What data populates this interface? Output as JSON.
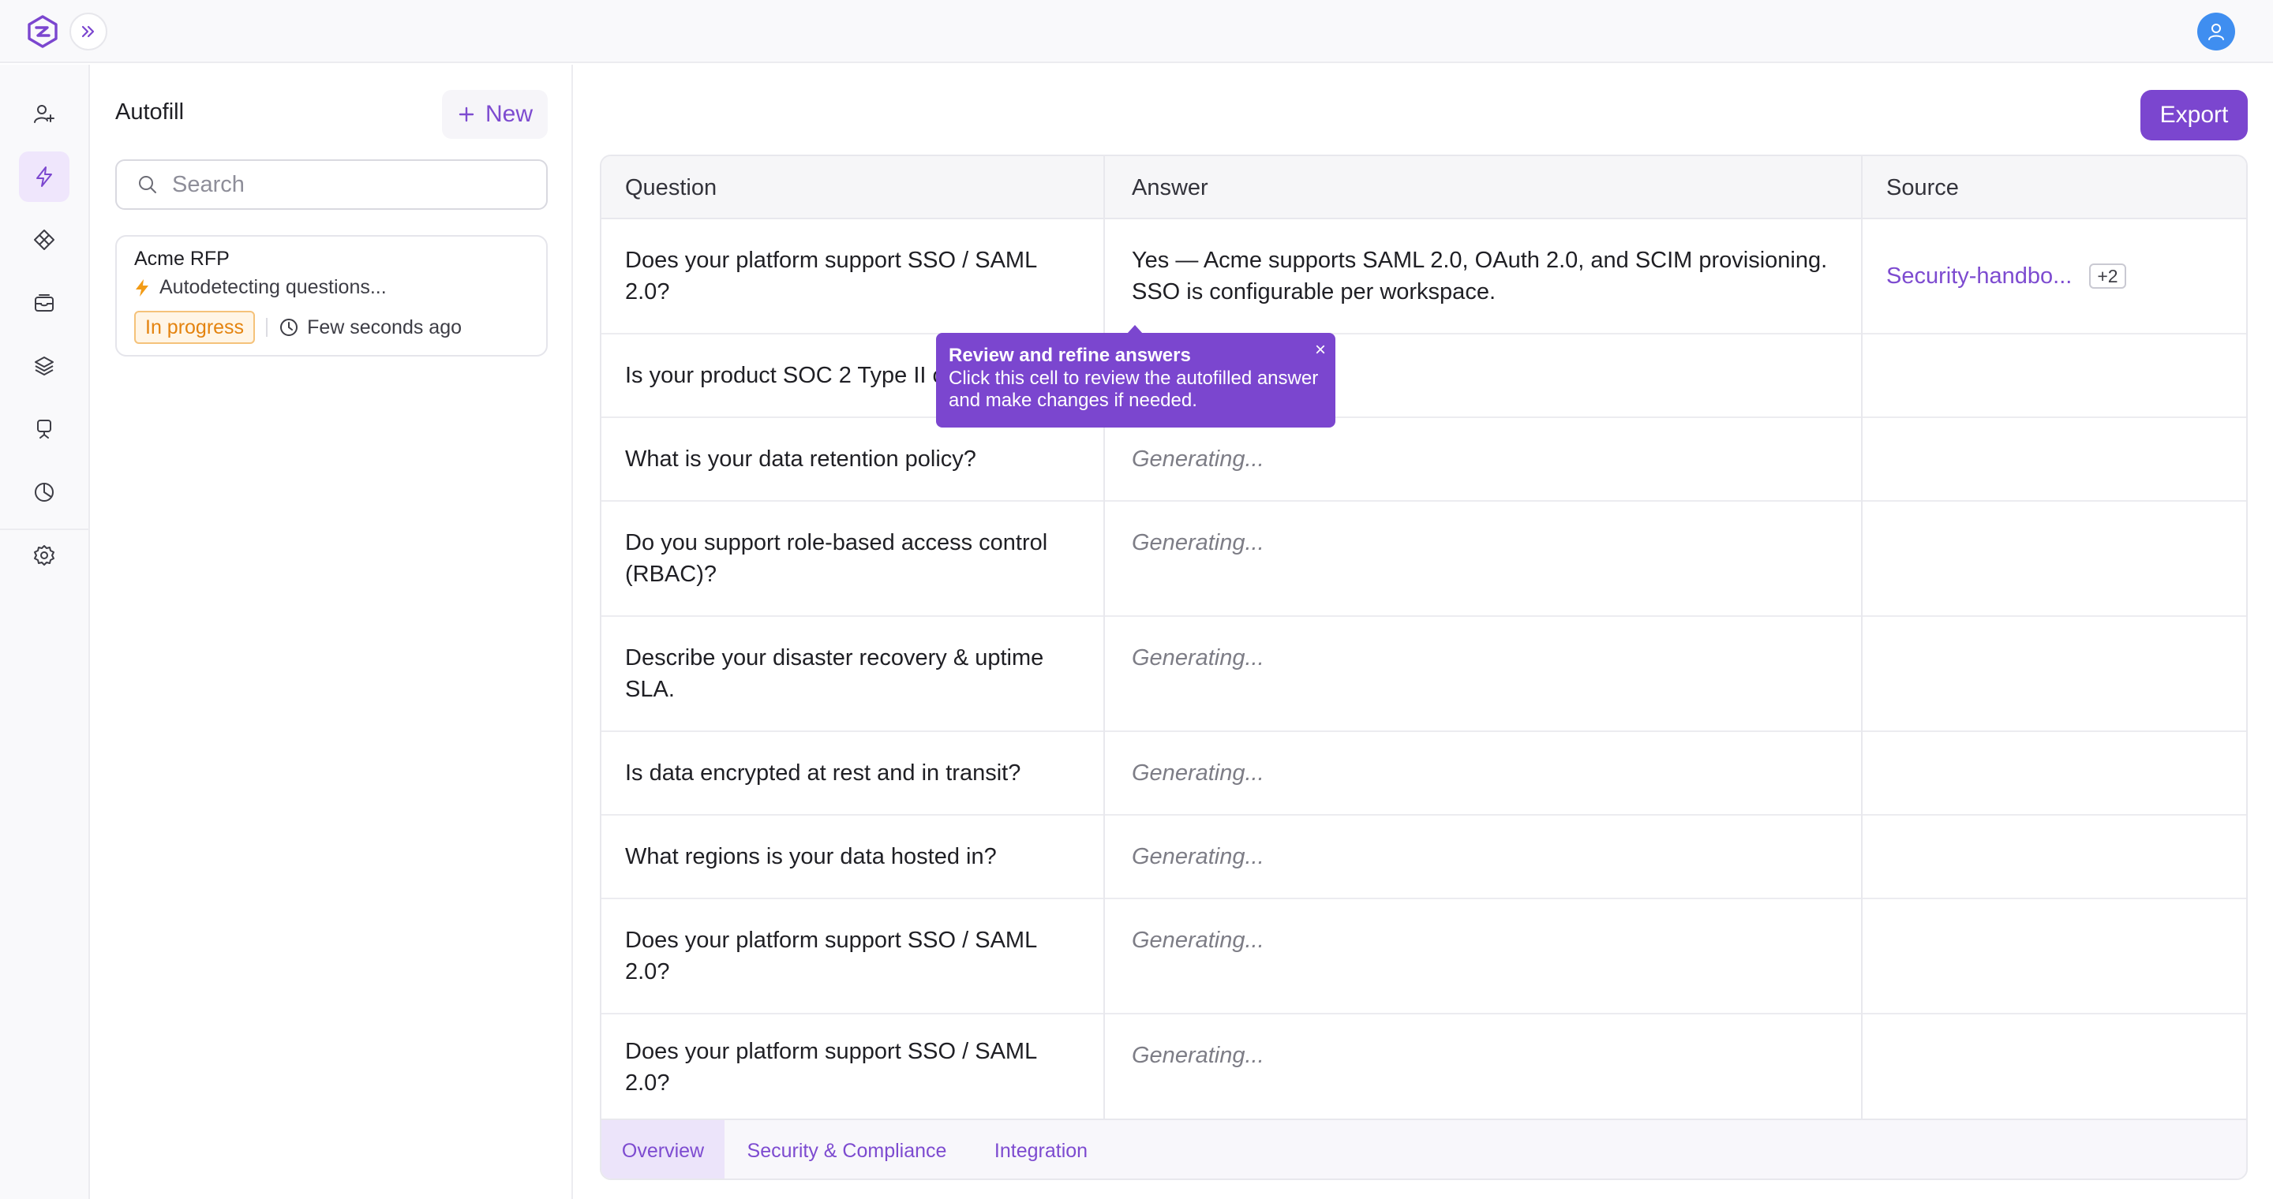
{
  "app": {
    "user_icon": "user-icon",
    "expand_icon": "chevrons-right-icon"
  },
  "rail": {
    "items": [
      {
        "icon": "user-plus-icon",
        "active": false
      },
      {
        "icon": "zap-icon",
        "active": true
      },
      {
        "icon": "grid-diamond-icon",
        "active": false
      },
      {
        "icon": "inbox-icon",
        "active": false
      },
      {
        "icon": "layers-icon",
        "active": false
      },
      {
        "icon": "presentation-icon",
        "active": false
      },
      {
        "icon": "pie-chart-icon",
        "active": false
      },
      {
        "icon": "gear-icon",
        "active": false
      }
    ]
  },
  "panel": {
    "title": "Autofill",
    "new_label": "New",
    "search_placeholder": "Search",
    "card": {
      "title": "Acme RFP",
      "subtitle": "Autodetecting questions...",
      "status": "In progress",
      "time": "Few seconds ago"
    }
  },
  "main": {
    "export_label": "Export",
    "columns": {
      "question": "Question",
      "answer": "Answer",
      "source": "Source"
    },
    "rows": [
      {
        "question": "Does your platform support SSO / SAML 2.0?",
        "answer": "Yes — Acme supports SAML 2.0, OAuth 2.0, and SCIM provisioning. SSO is configurable per workspace.",
        "source": "Security-handbo...",
        "source_more": "+2"
      },
      {
        "question": "Is your product SOC 2 Type II c",
        "answer": "",
        "source": "",
        "source_more": ""
      },
      {
        "question": "What is your data retention policy?",
        "answer": "Generating...",
        "source": "",
        "source_more": ""
      },
      {
        "question": "Do you support role-based access control (RBAC)?",
        "answer": "Generating...",
        "source": "",
        "source_more": ""
      },
      {
        "question": "Describe your disaster recovery & uptime SLA.",
        "answer": "Generating...",
        "source": "",
        "source_more": ""
      },
      {
        "question": "Is data encrypted at rest and in transit?",
        "answer": "Generating...",
        "source": "",
        "source_more": ""
      },
      {
        "question": "What regions is your data hosted in?",
        "answer": "Generating...",
        "source": "",
        "source_more": ""
      },
      {
        "question": "Does your platform support SSO / SAML 2.0?",
        "answer": "Generating...",
        "source": "",
        "source_more": ""
      },
      {
        "question": "Does your platform support SSO / SAML 2.0?",
        "answer": "Generating...",
        "source": "",
        "source_more": ""
      }
    ],
    "tabs": [
      {
        "label": "Overview",
        "active": true
      },
      {
        "label": "Security & Compliance",
        "active": false
      },
      {
        "label": "Integration",
        "active": false
      }
    ],
    "tooltip": {
      "title": "Review and refine answers",
      "body": "Click this cell to review the autofilled answer and make changes if needed.",
      "close": "×"
    }
  },
  "colors": {
    "accent": "#7b46cf",
    "accent_light": "#efe6fc",
    "status_warning": "#e4830f",
    "avatar": "#3f8ef0"
  }
}
